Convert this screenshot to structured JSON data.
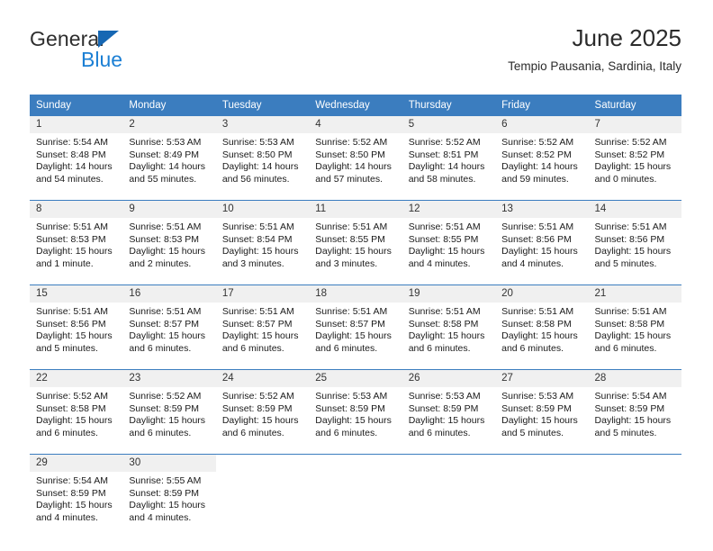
{
  "brand": {
    "name_top": "General",
    "name_bottom": "Blue",
    "triangle_color": "#1667b3",
    "blue_color": "#1b7fd4"
  },
  "header": {
    "title": "June 2025",
    "subtitle": "Tempio Pausania, Sardinia, Italy"
  },
  "theme": {
    "header_bg": "#3b7dbf",
    "daynum_bg": "#f0f0f0",
    "cell_bg": "#ffffff"
  },
  "weekdays": [
    "Sunday",
    "Monday",
    "Tuesday",
    "Wednesday",
    "Thursday",
    "Friday",
    "Saturday"
  ],
  "days": [
    {
      "num": "1",
      "sunrise": "Sunrise: 5:54 AM",
      "sunset": "Sunset: 8:48 PM",
      "daylight_1": "Daylight: 14 hours",
      "daylight_2": "and 54 minutes."
    },
    {
      "num": "2",
      "sunrise": "Sunrise: 5:53 AM",
      "sunset": "Sunset: 8:49 PM",
      "daylight_1": "Daylight: 14 hours",
      "daylight_2": "and 55 minutes."
    },
    {
      "num": "3",
      "sunrise": "Sunrise: 5:53 AM",
      "sunset": "Sunset: 8:50 PM",
      "daylight_1": "Daylight: 14 hours",
      "daylight_2": "and 56 minutes."
    },
    {
      "num": "4",
      "sunrise": "Sunrise: 5:52 AM",
      "sunset": "Sunset: 8:50 PM",
      "daylight_1": "Daylight: 14 hours",
      "daylight_2": "and 57 minutes."
    },
    {
      "num": "5",
      "sunrise": "Sunrise: 5:52 AM",
      "sunset": "Sunset: 8:51 PM",
      "daylight_1": "Daylight: 14 hours",
      "daylight_2": "and 58 minutes."
    },
    {
      "num": "6",
      "sunrise": "Sunrise: 5:52 AM",
      "sunset": "Sunset: 8:52 PM",
      "daylight_1": "Daylight: 14 hours",
      "daylight_2": "and 59 minutes."
    },
    {
      "num": "7",
      "sunrise": "Sunrise: 5:52 AM",
      "sunset": "Sunset: 8:52 PM",
      "daylight_1": "Daylight: 15 hours",
      "daylight_2": "and 0 minutes."
    },
    {
      "num": "8",
      "sunrise": "Sunrise: 5:51 AM",
      "sunset": "Sunset: 8:53 PM",
      "daylight_1": "Daylight: 15 hours",
      "daylight_2": "and 1 minute."
    },
    {
      "num": "9",
      "sunrise": "Sunrise: 5:51 AM",
      "sunset": "Sunset: 8:53 PM",
      "daylight_1": "Daylight: 15 hours",
      "daylight_2": "and 2 minutes."
    },
    {
      "num": "10",
      "sunrise": "Sunrise: 5:51 AM",
      "sunset": "Sunset: 8:54 PM",
      "daylight_1": "Daylight: 15 hours",
      "daylight_2": "and 3 minutes."
    },
    {
      "num": "11",
      "sunrise": "Sunrise: 5:51 AM",
      "sunset": "Sunset: 8:55 PM",
      "daylight_1": "Daylight: 15 hours",
      "daylight_2": "and 3 minutes."
    },
    {
      "num": "12",
      "sunrise": "Sunrise: 5:51 AM",
      "sunset": "Sunset: 8:55 PM",
      "daylight_1": "Daylight: 15 hours",
      "daylight_2": "and 4 minutes."
    },
    {
      "num": "13",
      "sunrise": "Sunrise: 5:51 AM",
      "sunset": "Sunset: 8:56 PM",
      "daylight_1": "Daylight: 15 hours",
      "daylight_2": "and 4 minutes."
    },
    {
      "num": "14",
      "sunrise": "Sunrise: 5:51 AM",
      "sunset": "Sunset: 8:56 PM",
      "daylight_1": "Daylight: 15 hours",
      "daylight_2": "and 5 minutes."
    },
    {
      "num": "15",
      "sunrise": "Sunrise: 5:51 AM",
      "sunset": "Sunset: 8:56 PM",
      "daylight_1": "Daylight: 15 hours",
      "daylight_2": "and 5 minutes."
    },
    {
      "num": "16",
      "sunrise": "Sunrise: 5:51 AM",
      "sunset": "Sunset: 8:57 PM",
      "daylight_1": "Daylight: 15 hours",
      "daylight_2": "and 6 minutes."
    },
    {
      "num": "17",
      "sunrise": "Sunrise: 5:51 AM",
      "sunset": "Sunset: 8:57 PM",
      "daylight_1": "Daylight: 15 hours",
      "daylight_2": "and 6 minutes."
    },
    {
      "num": "18",
      "sunrise": "Sunrise: 5:51 AM",
      "sunset": "Sunset: 8:57 PM",
      "daylight_1": "Daylight: 15 hours",
      "daylight_2": "and 6 minutes."
    },
    {
      "num": "19",
      "sunrise": "Sunrise: 5:51 AM",
      "sunset": "Sunset: 8:58 PM",
      "daylight_1": "Daylight: 15 hours",
      "daylight_2": "and 6 minutes."
    },
    {
      "num": "20",
      "sunrise": "Sunrise: 5:51 AM",
      "sunset": "Sunset: 8:58 PM",
      "daylight_1": "Daylight: 15 hours",
      "daylight_2": "and 6 minutes."
    },
    {
      "num": "21",
      "sunrise": "Sunrise: 5:51 AM",
      "sunset": "Sunset: 8:58 PM",
      "daylight_1": "Daylight: 15 hours",
      "daylight_2": "and 6 minutes."
    },
    {
      "num": "22",
      "sunrise": "Sunrise: 5:52 AM",
      "sunset": "Sunset: 8:58 PM",
      "daylight_1": "Daylight: 15 hours",
      "daylight_2": "and 6 minutes."
    },
    {
      "num": "23",
      "sunrise": "Sunrise: 5:52 AM",
      "sunset": "Sunset: 8:59 PM",
      "daylight_1": "Daylight: 15 hours",
      "daylight_2": "and 6 minutes."
    },
    {
      "num": "24",
      "sunrise": "Sunrise: 5:52 AM",
      "sunset": "Sunset: 8:59 PM",
      "daylight_1": "Daylight: 15 hours",
      "daylight_2": "and 6 minutes."
    },
    {
      "num": "25",
      "sunrise": "Sunrise: 5:53 AM",
      "sunset": "Sunset: 8:59 PM",
      "daylight_1": "Daylight: 15 hours",
      "daylight_2": "and 6 minutes."
    },
    {
      "num": "26",
      "sunrise": "Sunrise: 5:53 AM",
      "sunset": "Sunset: 8:59 PM",
      "daylight_1": "Daylight: 15 hours",
      "daylight_2": "and 6 minutes."
    },
    {
      "num": "27",
      "sunrise": "Sunrise: 5:53 AM",
      "sunset": "Sunset: 8:59 PM",
      "daylight_1": "Daylight: 15 hours",
      "daylight_2": "and 5 minutes."
    },
    {
      "num": "28",
      "sunrise": "Sunrise: 5:54 AM",
      "sunset": "Sunset: 8:59 PM",
      "daylight_1": "Daylight: 15 hours",
      "daylight_2": "and 5 minutes."
    },
    {
      "num": "29",
      "sunrise": "Sunrise: 5:54 AM",
      "sunset": "Sunset: 8:59 PM",
      "daylight_1": "Daylight: 15 hours",
      "daylight_2": "and 4 minutes."
    },
    {
      "num": "30",
      "sunrise": "Sunrise: 5:55 AM",
      "sunset": "Sunset: 8:59 PM",
      "daylight_1": "Daylight: 15 hours",
      "daylight_2": "and 4 minutes."
    }
  ],
  "grid": {
    "leading_blanks": 0,
    "trailing_blanks": 5,
    "columns": 7
  }
}
